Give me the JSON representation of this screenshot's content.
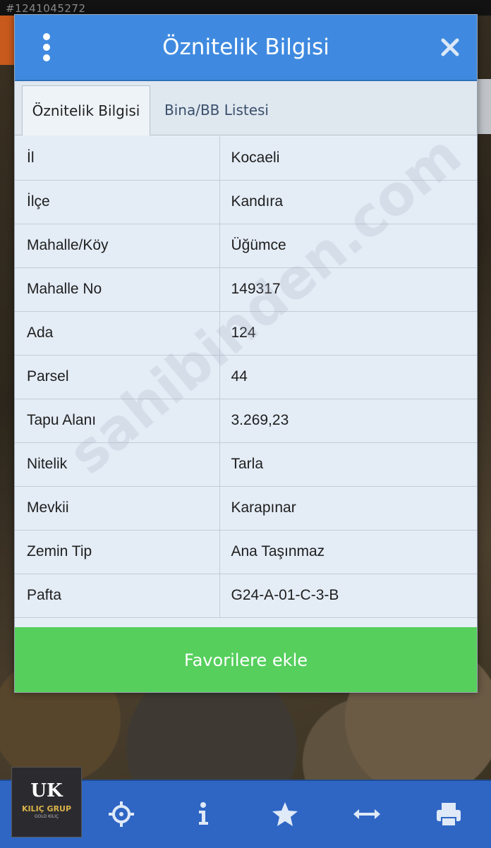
{
  "watermark_id": "#1241045272",
  "dialog": {
    "title": "Öznitelik Bilgisi",
    "menu_icon": "vertical-dots-icon",
    "close_icon": "close-icon"
  },
  "tabs": [
    {
      "label": "Öznitelik Bilgisi",
      "active": true
    },
    {
      "label": "Bina/BB Listesi",
      "active": false
    }
  ],
  "attributes": [
    {
      "key": "İl",
      "value": "Kocaeli"
    },
    {
      "key": "İlçe",
      "value": "Kandıra"
    },
    {
      "key": "Mahalle/Köy",
      "value": "Üğümce"
    },
    {
      "key": "Mahalle No",
      "value": "149317"
    },
    {
      "key": "Ada",
      "value": "124"
    },
    {
      "key": "Parsel",
      "value": "44"
    },
    {
      "key": "Tapu Alanı",
      "value": "3.269,23"
    },
    {
      "key": "Nitelik",
      "value": "Tarla"
    },
    {
      "key": "Mevkii",
      "value": "Karapınar"
    },
    {
      "key": "Zemin Tip",
      "value": "Ana Taşınmaz"
    },
    {
      "key": "Pafta",
      "value": "G24-A-01-C-3-B"
    }
  ],
  "favorite_button_label": "Favorilere ekle",
  "watermark_site": "sahibinden.com",
  "logo": {
    "mark": "UK",
    "text": "KILIÇ GRUP",
    "sub": "GOLD KILIÇ"
  },
  "toolbar": {
    "icons": [
      "locate-icon",
      "info-icon",
      "star-icon",
      "measure-icon",
      "print-icon"
    ]
  },
  "colors": {
    "header": "#3f8ae0",
    "favorite_button": "#56cf5d",
    "toolbar": "#2f66c4"
  }
}
